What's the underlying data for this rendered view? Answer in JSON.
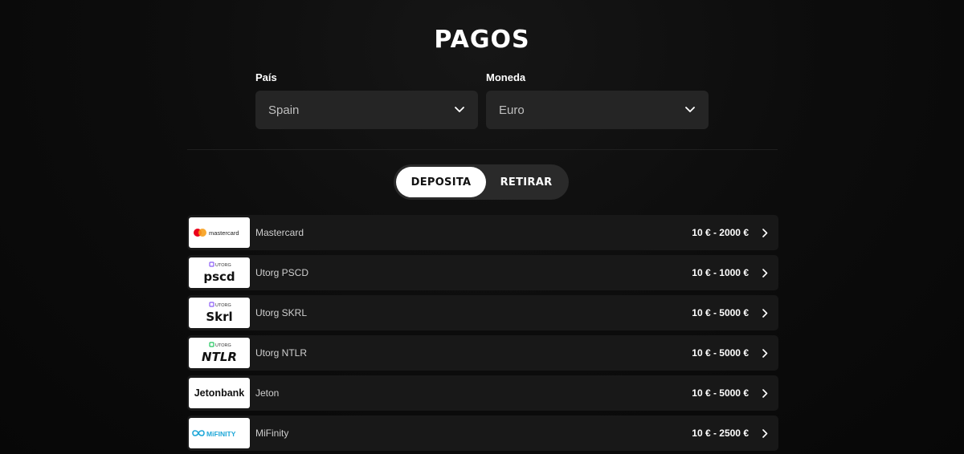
{
  "page": {
    "title": "PAGOS"
  },
  "filters": {
    "country_label": "País",
    "country_value": "Spain",
    "currency_label": "Moneda",
    "currency_value": "Euro"
  },
  "tabs": [
    {
      "label": "DEPOSITA",
      "active": true
    },
    {
      "label": "RETIRAR",
      "active": false
    }
  ],
  "methods": [
    {
      "name": "Mastercard",
      "range": "10 € - 2000 €",
      "logo": {
        "icon": "mastercard-logo",
        "text": "mastercard"
      }
    },
    {
      "name": "Utorg PSCD",
      "range": "10 € - 1000 €",
      "logo": {
        "icon": "utorg-pscd-logo",
        "small": "UTORG",
        "text": "pscd"
      }
    },
    {
      "name": "Utorg SKRL",
      "range": "10 € - 5000 €",
      "logo": {
        "icon": "utorg-skrl-logo",
        "small": "UTORG",
        "text": "Skrl"
      }
    },
    {
      "name": "Utorg NTLR",
      "range": "10 € - 5000 €",
      "logo": {
        "icon": "utorg-ntlr-logo",
        "small": "UTORG",
        "text": "NTLR"
      }
    },
    {
      "name": "Jeton",
      "range": "10 € - 5000 €",
      "logo": {
        "icon": "jetonbank-logo",
        "text": "Jetonbank"
      }
    },
    {
      "name": "MiFinity",
      "range": "10 € - 2500 €",
      "logo": {
        "icon": "mifinity-logo",
        "text": "MiFINITY"
      }
    }
  ],
  "colors": {
    "background": "#0b0b0b",
    "select_bg": "#252525",
    "row_bg": "#181818",
    "active_tab_bg": "#ffffff",
    "mastercard_red": "#eb001b",
    "mastercard_orange": "#f79e1b",
    "utorg_purple": "#8b5cf6",
    "utorg_green": "#22c55e",
    "mifinity_blue": "#1ea7d8"
  }
}
